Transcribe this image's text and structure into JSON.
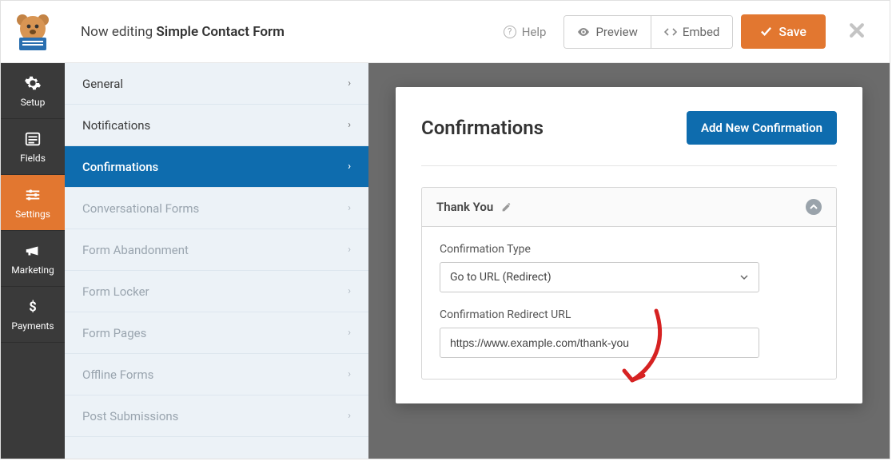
{
  "header": {
    "editing_prefix": "Now editing ",
    "form_name": "Simple Contact Form",
    "help": "Help",
    "preview": "Preview",
    "embed": "Embed",
    "save": "Save"
  },
  "nav": {
    "setup": "Setup",
    "fields": "Fields",
    "settings": "Settings",
    "marketing": "Marketing",
    "payments": "Payments"
  },
  "sidebar": {
    "general": "General",
    "notifications": "Notifications",
    "confirmations": "Confirmations",
    "conversational": "Conversational Forms",
    "abandonment": "Form Abandonment",
    "locker": "Form Locker",
    "pages": "Form Pages",
    "offline": "Offline Forms",
    "post_submissions": "Post Submissions"
  },
  "panel": {
    "title": "Confirmations",
    "add_button": "Add New Confirmation",
    "confirmation_name": "Thank You",
    "type_label": "Confirmation Type",
    "type_value": "Go to URL (Redirect)",
    "redirect_label": "Confirmation Redirect URL",
    "redirect_value": "https://www.example.com/thank-you"
  }
}
